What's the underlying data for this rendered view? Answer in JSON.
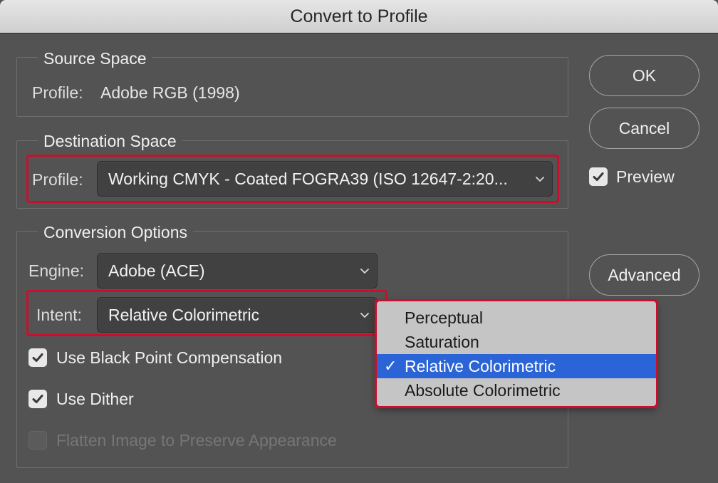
{
  "window": {
    "title": "Convert to Profile"
  },
  "source_space": {
    "legend": "Source Space",
    "profile_label": "Profile:",
    "profile_value": "Adobe RGB (1998)"
  },
  "destination_space": {
    "legend": "Destination Space",
    "profile_label": "Profile:",
    "profile_value": "Working CMYK - Coated FOGRA39 (ISO 12647-2:20..."
  },
  "conversion_options": {
    "legend": "Conversion Options",
    "engine_label": "Engine:",
    "engine_value": "Adobe (ACE)",
    "intent_label": "Intent:",
    "intent_value": "Relative Colorimetric",
    "black_point_label": "Use Black Point Compensation",
    "black_point_checked": true,
    "dither_label": "Use Dither",
    "dither_checked": true,
    "flatten_label": "Flatten Image to Preserve Appearance",
    "flatten_checked": false,
    "flatten_enabled": false
  },
  "buttons": {
    "ok": "OK",
    "cancel": "Cancel",
    "advanced": "Advanced"
  },
  "preview": {
    "label": "Preview",
    "checked": true
  },
  "intent_menu": {
    "items": [
      {
        "label": "Perceptual",
        "selected": false
      },
      {
        "label": "Saturation",
        "selected": false
      },
      {
        "label": "Relative Colorimetric",
        "selected": true
      },
      {
        "label": "Absolute Colorimetric",
        "selected": false
      }
    ],
    "check_glyph": "✓"
  },
  "colors": {
    "highlight": "#c8102e",
    "menu_selected": "#2a64d6",
    "dialog_bg": "#535353"
  }
}
